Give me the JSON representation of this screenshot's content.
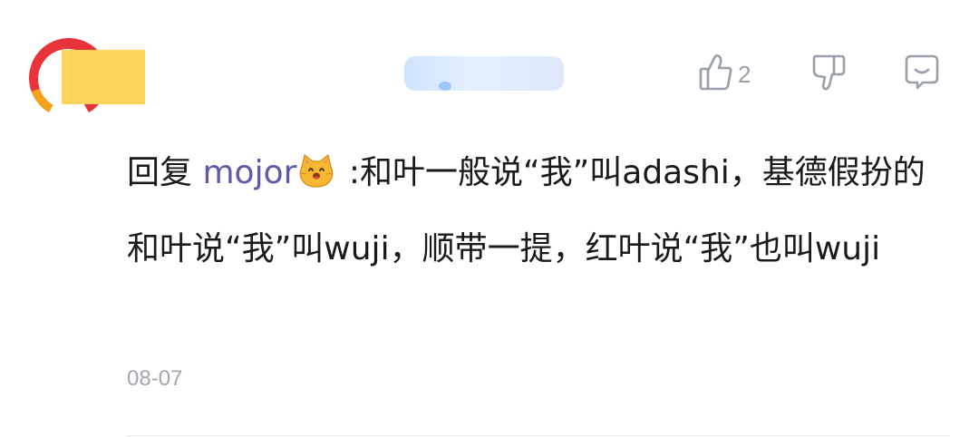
{
  "comment": {
    "like_count": "2",
    "reply_prefix": "回复",
    "mention": "mojor",
    "mention_emoji": "cat-emoji",
    "text_after_mention": " :和叶一般说“我”叫adashi，基德假扮的和叶说“我”叫wuji，顺带一提，红叶说“我”也叫wuji",
    "date": "08-07"
  },
  "icons": {
    "like": "thumbs-up-icon",
    "dislike": "thumbs-down-icon",
    "reply": "reply-bubble-icon"
  },
  "colors": {
    "mention": "#5e5aa8",
    "text": "#1a1a1a",
    "muted": "#9aa0aa",
    "avatar_ring": "#e8333a"
  }
}
